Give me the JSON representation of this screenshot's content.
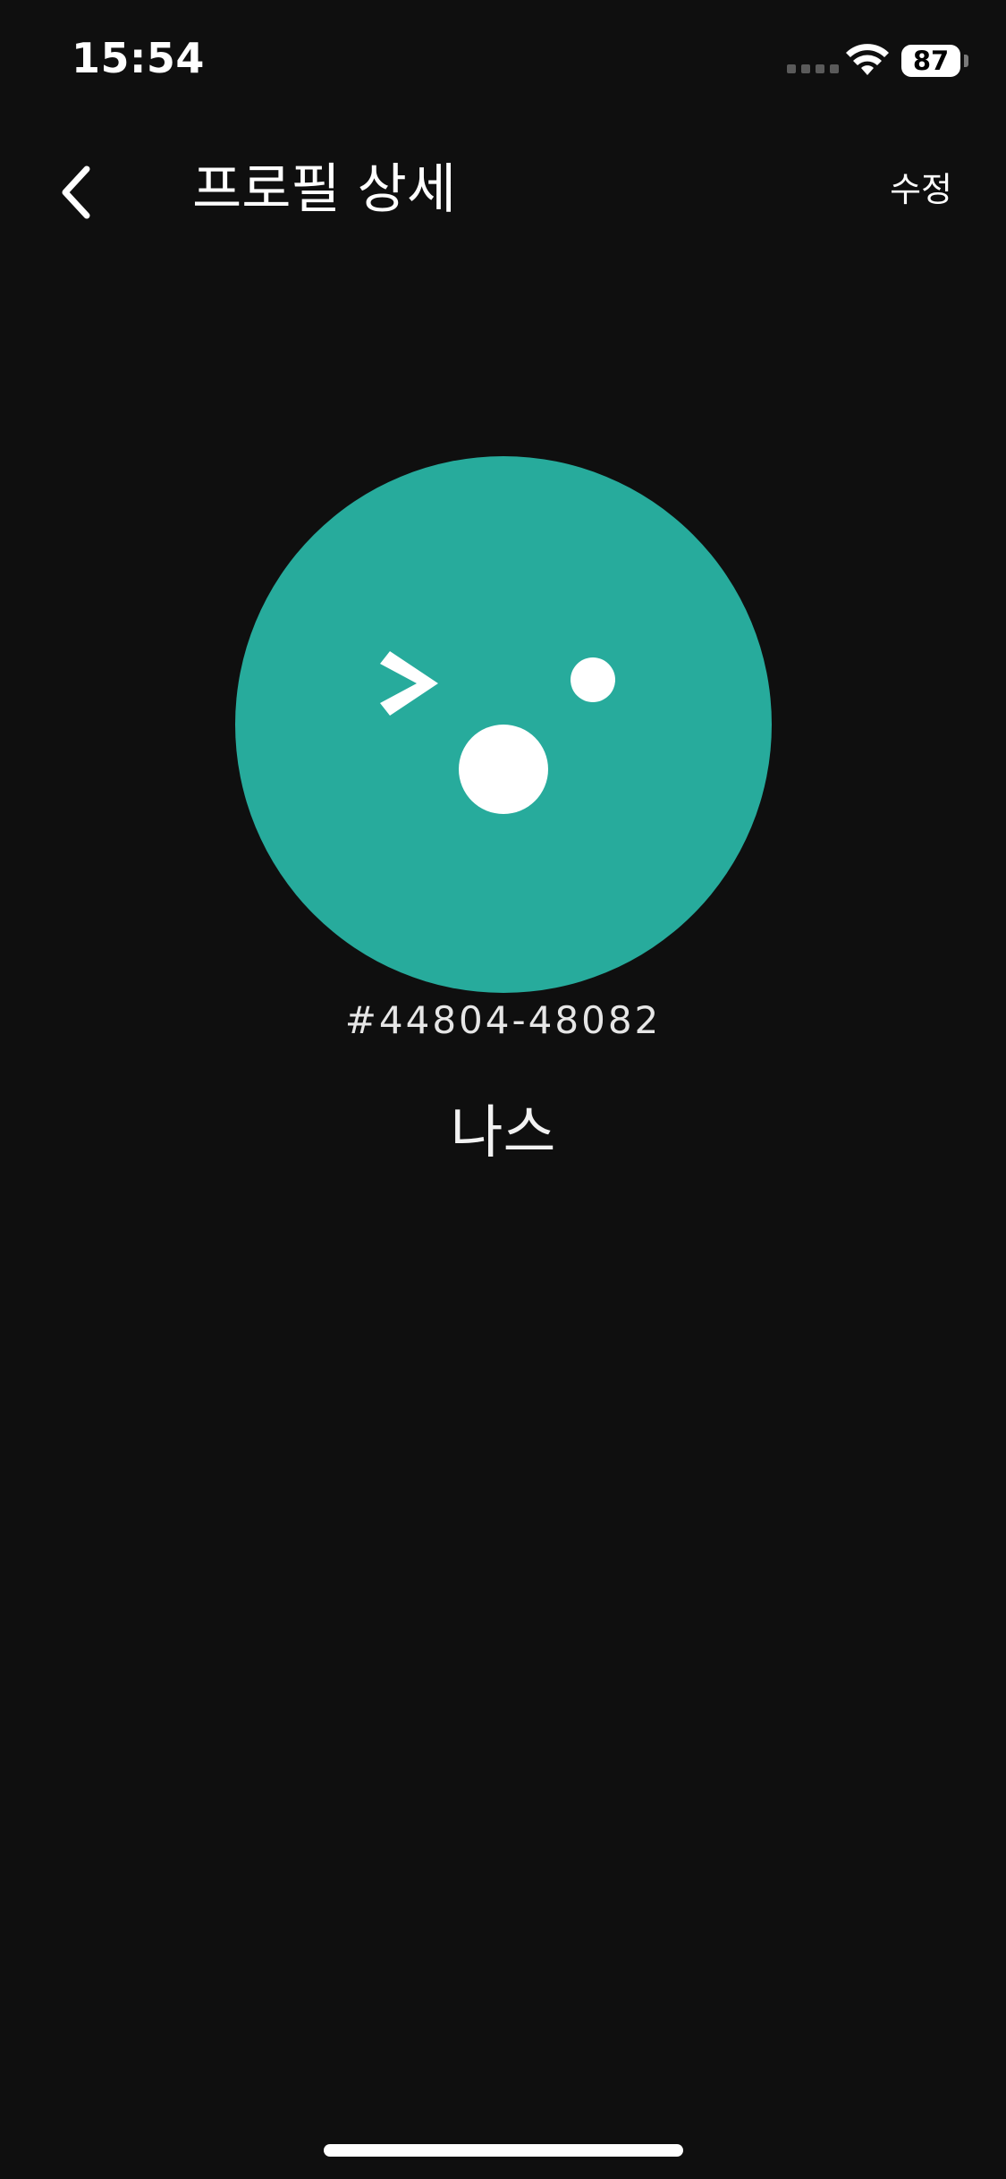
{
  "status_bar": {
    "time": "15:54",
    "battery_level": "87",
    "battery_percent": 87,
    "icons": [
      "signal-icon",
      "wifi-icon",
      "battery-icon"
    ]
  },
  "header": {
    "back_icon": "chevron-left-icon",
    "title": "프로필 상세",
    "edit_label": "수정"
  },
  "profile": {
    "avatar_color": "#27ab9c",
    "avatar_icon": "face-avatar",
    "tag": "#44804-48082",
    "name": "나스"
  },
  "colors": {
    "background": "#0f0f0f",
    "text": "#ffffff",
    "accent": "#27ab9c"
  }
}
